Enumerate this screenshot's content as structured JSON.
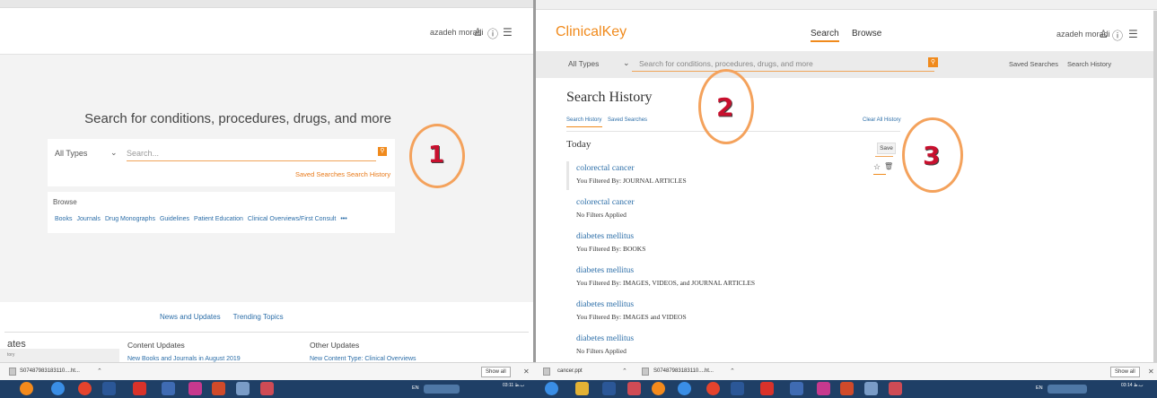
{
  "left": {
    "user": "azadeh moradi",
    "heading": "Search for conditions, procedures, drugs, and more",
    "types": "All Types",
    "search_placeholder": "Search...",
    "saved_searches": "Saved Searches",
    "search_history": "Search History",
    "browse_label": "Browse",
    "browse_links": [
      "Books",
      "Journals",
      "Drug Monographs",
      "Guidelines",
      "Patient Education",
      "Clinical Overviews/First Consult",
      "•••"
    ],
    "footer_tabs": [
      "News and Updates",
      "Trending Topics"
    ],
    "footer_cut_heading": "ates",
    "footer_cut_sub": "tory",
    "content_updates": "Content Updates",
    "other_updates": "Other Updates",
    "content_updates_item": "New Books and Journals in August 2019",
    "other_updates_item": "New Content Type: Clinical Overviews"
  },
  "right": {
    "logo": "ClinicalKey",
    "nav": [
      "Search",
      "Browse"
    ],
    "user": "azadeh moradi",
    "types": "All Types",
    "search_placeholder": "Search for conditions, procedures, drugs, and more",
    "saved_searches": "Saved Searches",
    "search_history": "Search History",
    "title": "Search History",
    "tabs": [
      "Search History",
      "Saved Searches"
    ],
    "clear_all": "Clear All History",
    "section": "Today",
    "save_label": "Save",
    "entries": [
      {
        "query": "colorectal cancer",
        "filter": "You Filtered By: JOURNAL ARTICLES"
      },
      {
        "query": "colorectal cancer",
        "filter": "No Filters Applied"
      },
      {
        "query": "diabetes mellitus",
        "filter": "You Filtered By: BOOKS"
      },
      {
        "query": "diabetes mellitus",
        "filter": "You Filtered By: IMAGES, VIDEOS, and JOURNAL ARTICLES"
      },
      {
        "query": "diabetes mellitus",
        "filter": "You Filtered By: IMAGES and VIDEOS"
      },
      {
        "query": "diabetes mellitus",
        "filter": "No Filters Applied"
      }
    ]
  },
  "annotations": [
    "1",
    "2",
    "3"
  ],
  "downloads_left": {
    "file": "S07487983183110....ht...",
    "show_all": "Show all"
  },
  "downloads_right": {
    "file1": "cancer.ppt",
    "file2": "S07487983183110....ht...",
    "show_all": "Show all"
  },
  "taskbar": {
    "lang": "EN",
    "clock_left": "03:11 ب.ظ",
    "clock_right": "03:14 ب.ظ"
  },
  "colors": {
    "accent": "#f08a1c",
    "link": "#2c6ea8",
    "annotation_circle": "#f4a25c",
    "annotation_number": "#c8102e",
    "taskbar": "#1f3f66"
  }
}
